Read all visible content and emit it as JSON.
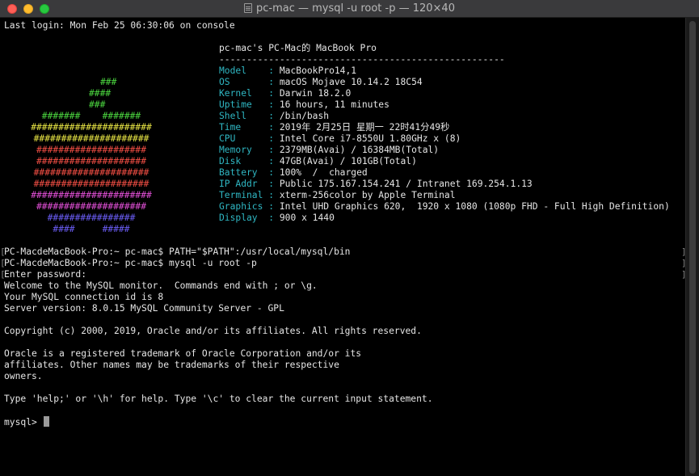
{
  "window": {
    "title": "pc-mac — mysql -u root -p — 120×40"
  },
  "terminal": {
    "last_login": "Last login: Mon Feb 25 06:30:06 on console",
    "header": "pc-mac's PC-Mac的 MacBook Pro",
    "divider": "----------------------------------------------------",
    "sysinfo": [
      {
        "key": "Model   ",
        "value": "MacBookPro14,1"
      },
      {
        "key": "OS      ",
        "value": "macOS Mojave 10.14.2 18C54"
      },
      {
        "key": "Kernel  ",
        "value": "Darwin 18.2.0"
      },
      {
        "key": "Uptime  ",
        "value": "16 hours, 11 minutes"
      },
      {
        "key": "Shell   ",
        "value": "/bin/bash"
      },
      {
        "key": "Time    ",
        "value": "2019年 2月25日 星期一 22时41分49秒"
      },
      {
        "key": "CPU     ",
        "value": "Intel Core i7-8550U 1.80GHz x (8)"
      },
      {
        "key": "Memory  ",
        "value": "2379MB(Avai) / 16384MB(Total)"
      },
      {
        "key": "Disk    ",
        "value": "47GB(Avai) / 101GB(Total)"
      },
      {
        "key": "Battery ",
        "value": "100%  /  charged"
      },
      {
        "key": "IP Addr ",
        "value": "Public 175.167.154.241 / Intranet 169.254.1.13"
      },
      {
        "key": "Terminal",
        "value": "xterm-256color by Apple Terminal"
      },
      {
        "key": "Graphics",
        "value": "Intel UHD Graphics 620,  1920 x 1080 (1080p FHD - Full High Definition)"
      },
      {
        "key": "Display ",
        "value": "900 x 1440"
      }
    ],
    "logo": [
      {
        "text": "###",
        "color": "#4bd63f"
      },
      {
        "text": "####",
        "color": "#4bd63f"
      },
      {
        "text": "###",
        "color": "#4bd63f"
      },
      {
        "text": "#######    #######",
        "color": "#4bd63f"
      },
      {
        "text": "######################",
        "color": "#e7e444"
      },
      {
        "text": "#####################",
        "color": "#e7e444"
      },
      {
        "text": "####################",
        "color": "#f24e44"
      },
      {
        "text": "####################",
        "color": "#f24e44"
      },
      {
        "text": "#####################",
        "color": "#f24e44"
      },
      {
        "text": "#####################",
        "color": "#f24e44"
      },
      {
        "text": "######################",
        "color": "#e14fd6"
      },
      {
        "text": "####################",
        "color": "#e14fd6"
      },
      {
        "text": "################",
        "color": "#6a5cf4"
      },
      {
        "text": "####     #####",
        "color": "#6a5cf4"
      }
    ],
    "separator": ":",
    "lines": [
      "PC-MacdeMacBook-Pro:~ pc-mac$ PATH=\"$PATH\":/usr/local/mysql/bin",
      "PC-MacdeMacBook-Pro:~ pc-mac$ mysql -u root -p",
      "Enter password:",
      "Welcome to the MySQL monitor.  Commands end with ; or \\g.",
      "Your MySQL connection id is 8",
      "Server version: 8.0.15 MySQL Community Server - GPL",
      "",
      "Copyright (c) 2000, 2019, Oracle and/or its affiliates. All rights reserved.",
      "",
      "Oracle is a registered trademark of Oracle Corporation and/or its",
      "affiliates. Other names may be trademarks of their respective",
      "owners.",
      "",
      "Type 'help;' or '\\h' for help. Type '\\c' to clear the current input statement.",
      ""
    ],
    "prompt": "mysql> "
  }
}
